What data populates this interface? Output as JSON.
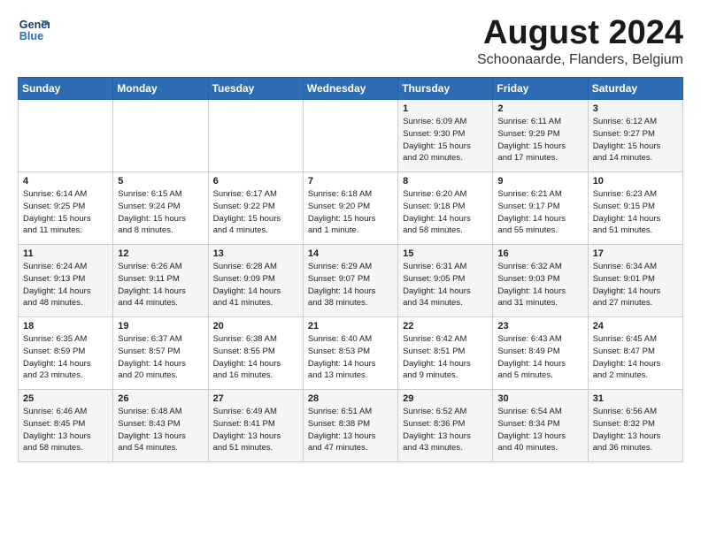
{
  "logo": {
    "line1": "General",
    "line2": "Blue"
  },
  "title": "August 2024",
  "location": "Schoonaarde, Flanders, Belgium",
  "days_header": [
    "Sunday",
    "Monday",
    "Tuesday",
    "Wednesday",
    "Thursday",
    "Friday",
    "Saturday"
  ],
  "weeks": [
    [
      {
        "day": "",
        "info": ""
      },
      {
        "day": "",
        "info": ""
      },
      {
        "day": "",
        "info": ""
      },
      {
        "day": "",
        "info": ""
      },
      {
        "day": "1",
        "info": "Sunrise: 6:09 AM\nSunset: 9:30 PM\nDaylight: 15 hours\nand 20 minutes."
      },
      {
        "day": "2",
        "info": "Sunrise: 6:11 AM\nSunset: 9:29 PM\nDaylight: 15 hours\nand 17 minutes."
      },
      {
        "day": "3",
        "info": "Sunrise: 6:12 AM\nSunset: 9:27 PM\nDaylight: 15 hours\nand 14 minutes."
      }
    ],
    [
      {
        "day": "4",
        "info": "Sunrise: 6:14 AM\nSunset: 9:25 PM\nDaylight: 15 hours\nand 11 minutes."
      },
      {
        "day": "5",
        "info": "Sunrise: 6:15 AM\nSunset: 9:24 PM\nDaylight: 15 hours\nand 8 minutes."
      },
      {
        "day": "6",
        "info": "Sunrise: 6:17 AM\nSunset: 9:22 PM\nDaylight: 15 hours\nand 4 minutes."
      },
      {
        "day": "7",
        "info": "Sunrise: 6:18 AM\nSunset: 9:20 PM\nDaylight: 15 hours\nand 1 minute."
      },
      {
        "day": "8",
        "info": "Sunrise: 6:20 AM\nSunset: 9:18 PM\nDaylight: 14 hours\nand 58 minutes."
      },
      {
        "day": "9",
        "info": "Sunrise: 6:21 AM\nSunset: 9:17 PM\nDaylight: 14 hours\nand 55 minutes."
      },
      {
        "day": "10",
        "info": "Sunrise: 6:23 AM\nSunset: 9:15 PM\nDaylight: 14 hours\nand 51 minutes."
      }
    ],
    [
      {
        "day": "11",
        "info": "Sunrise: 6:24 AM\nSunset: 9:13 PM\nDaylight: 14 hours\nand 48 minutes."
      },
      {
        "day": "12",
        "info": "Sunrise: 6:26 AM\nSunset: 9:11 PM\nDaylight: 14 hours\nand 44 minutes."
      },
      {
        "day": "13",
        "info": "Sunrise: 6:28 AM\nSunset: 9:09 PM\nDaylight: 14 hours\nand 41 minutes."
      },
      {
        "day": "14",
        "info": "Sunrise: 6:29 AM\nSunset: 9:07 PM\nDaylight: 14 hours\nand 38 minutes."
      },
      {
        "day": "15",
        "info": "Sunrise: 6:31 AM\nSunset: 9:05 PM\nDaylight: 14 hours\nand 34 minutes."
      },
      {
        "day": "16",
        "info": "Sunrise: 6:32 AM\nSunset: 9:03 PM\nDaylight: 14 hours\nand 31 minutes."
      },
      {
        "day": "17",
        "info": "Sunrise: 6:34 AM\nSunset: 9:01 PM\nDaylight: 14 hours\nand 27 minutes."
      }
    ],
    [
      {
        "day": "18",
        "info": "Sunrise: 6:35 AM\nSunset: 8:59 PM\nDaylight: 14 hours\nand 23 minutes."
      },
      {
        "day": "19",
        "info": "Sunrise: 6:37 AM\nSunset: 8:57 PM\nDaylight: 14 hours\nand 20 minutes."
      },
      {
        "day": "20",
        "info": "Sunrise: 6:38 AM\nSunset: 8:55 PM\nDaylight: 14 hours\nand 16 minutes."
      },
      {
        "day": "21",
        "info": "Sunrise: 6:40 AM\nSunset: 8:53 PM\nDaylight: 14 hours\nand 13 minutes."
      },
      {
        "day": "22",
        "info": "Sunrise: 6:42 AM\nSunset: 8:51 PM\nDaylight: 14 hours\nand 9 minutes."
      },
      {
        "day": "23",
        "info": "Sunrise: 6:43 AM\nSunset: 8:49 PM\nDaylight: 14 hours\nand 5 minutes."
      },
      {
        "day": "24",
        "info": "Sunrise: 6:45 AM\nSunset: 8:47 PM\nDaylight: 14 hours\nand 2 minutes."
      }
    ],
    [
      {
        "day": "25",
        "info": "Sunrise: 6:46 AM\nSunset: 8:45 PM\nDaylight: 13 hours\nand 58 minutes."
      },
      {
        "day": "26",
        "info": "Sunrise: 6:48 AM\nSunset: 8:43 PM\nDaylight: 13 hours\nand 54 minutes."
      },
      {
        "day": "27",
        "info": "Sunrise: 6:49 AM\nSunset: 8:41 PM\nDaylight: 13 hours\nand 51 minutes."
      },
      {
        "day": "28",
        "info": "Sunrise: 6:51 AM\nSunset: 8:38 PM\nDaylight: 13 hours\nand 47 minutes."
      },
      {
        "day": "29",
        "info": "Sunrise: 6:52 AM\nSunset: 8:36 PM\nDaylight: 13 hours\nand 43 minutes."
      },
      {
        "day": "30",
        "info": "Sunrise: 6:54 AM\nSunset: 8:34 PM\nDaylight: 13 hours\nand 40 minutes."
      },
      {
        "day": "31",
        "info": "Sunrise: 6:56 AM\nSunset: 8:32 PM\nDaylight: 13 hours\nand 36 minutes."
      }
    ]
  ]
}
